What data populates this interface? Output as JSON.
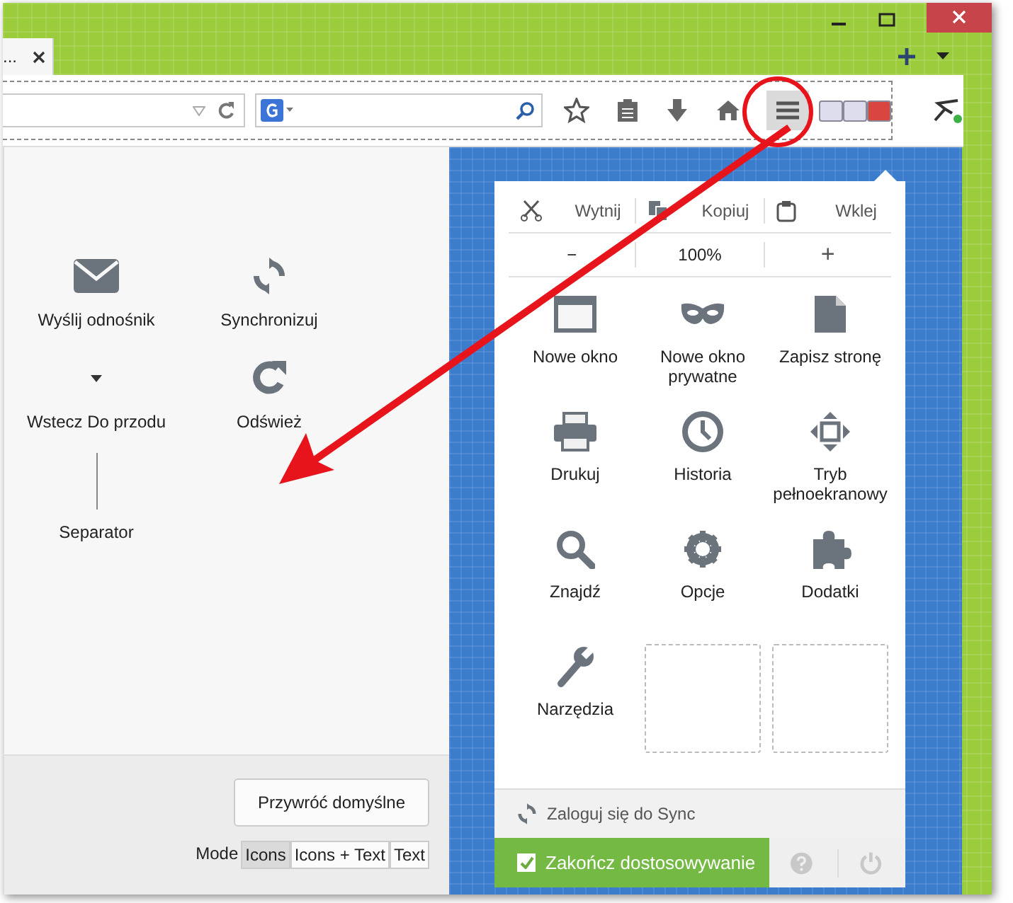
{
  "tab": {
    "title": "..."
  },
  "palette": {
    "items": [
      {
        "label": "Wyślij odnośnik",
        "kind": "mail"
      },
      {
        "label": "Synchronizuj",
        "kind": "sync"
      },
      {
        "label": "Wstecz Do przodu",
        "kind": "backforward"
      },
      {
        "label": "Odśwież",
        "kind": "reload"
      },
      {
        "label": "Separator",
        "kind": "separator"
      }
    ]
  },
  "restore_button": "Przywróć domyślne",
  "mode": {
    "label": "Mode",
    "options": [
      {
        "label": "Icons",
        "selected": true
      },
      {
        "label": "Icons + Text",
        "selected": false
      },
      {
        "label": "Text",
        "selected": false
      }
    ]
  },
  "menu_panel": {
    "edit": [
      {
        "label": "Wytnij",
        "kind": "cut"
      },
      {
        "label": "Kopiuj",
        "kind": "copy"
      },
      {
        "label": "Wklej",
        "kind": "paste"
      }
    ],
    "zoom": {
      "minus": "−",
      "value": "100%",
      "plus": "+"
    },
    "items": [
      {
        "label": "Nowe okno",
        "kind": "window"
      },
      {
        "label": "Nowe okno prywatne",
        "kind": "mask"
      },
      {
        "label": "Zapisz stronę",
        "kind": "page"
      },
      {
        "label": "Drukuj",
        "kind": "print"
      },
      {
        "label": "Historia",
        "kind": "clock"
      },
      {
        "label": "Tryb pełnoekranowy",
        "kind": "fullscreen"
      },
      {
        "label": "Znajdź",
        "kind": "search"
      },
      {
        "label": "Opcje",
        "kind": "gear"
      },
      {
        "label": "Dodatki",
        "kind": "puzzle"
      },
      {
        "label": "Narzędzia",
        "kind": "wrench"
      },
      {
        "kind": "empty"
      },
      {
        "kind": "empty"
      }
    ],
    "sync": "Zaloguj się do Sync",
    "finish": {
      "label": "Zakończ dostosowywanie",
      "checked": true
    }
  }
}
